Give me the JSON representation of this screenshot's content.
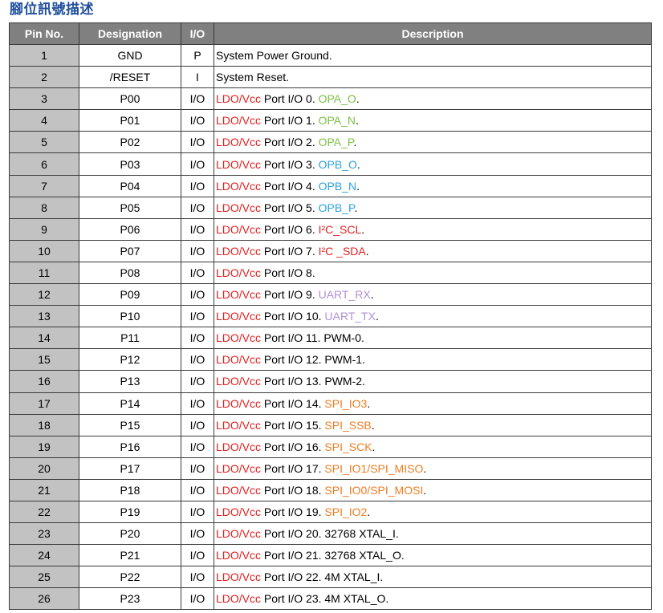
{
  "title": "腳位訊號描述",
  "headers": [
    "Pin No.",
    "Designation",
    "I/O",
    "Description"
  ],
  "colors": {
    "ldo": "#e51f1f",
    "green": "#7cc142",
    "blue": "#2aa3df",
    "purple": "#b28fd6",
    "orange": "#ef7d22",
    "header_bg": "#808080",
    "pin_bg": "#c2c2c2"
  },
  "rows": [
    {
      "pin": "1",
      "designation": "GND",
      "io": "P",
      "desc": [
        {
          "t": "System Power Ground.",
          "c": "bk"
        }
      ]
    },
    {
      "pin": "2",
      "designation": "/RESET",
      "io": "I",
      "desc": [
        {
          "t": "System Reset.",
          "c": "bk"
        }
      ]
    },
    {
      "pin": "3",
      "designation": "P00",
      "io": "I/O",
      "desc": [
        {
          "t": "LDO/Vcc",
          "c": "rd"
        },
        {
          "t": " Port I/O 0. ",
          "c": "bk"
        },
        {
          "t": "OPA_O",
          "c": "gn"
        },
        {
          "t": ".",
          "c": "bk"
        }
      ]
    },
    {
      "pin": "4",
      "designation": "P01",
      "io": "I/O",
      "desc": [
        {
          "t": "LDO/Vcc",
          "c": "rd"
        },
        {
          "t": " Port I/O 1. ",
          "c": "bk"
        },
        {
          "t": "OPA_N",
          "c": "gn"
        },
        {
          "t": ".",
          "c": "bk"
        }
      ]
    },
    {
      "pin": "5",
      "designation": "P02",
      "io": "I/O",
      "desc": [
        {
          "t": "LDO/Vcc",
          "c": "rd"
        },
        {
          "t": " Port I/O 2. ",
          "c": "bk"
        },
        {
          "t": "OPA_P",
          "c": "gn"
        },
        {
          "t": ".",
          "c": "bk"
        }
      ]
    },
    {
      "pin": "6",
      "designation": "P03",
      "io": "I/O",
      "desc": [
        {
          "t": "LDO/Vcc",
          "c": "rd"
        },
        {
          "t": " Port I/O 3. ",
          "c": "bk"
        },
        {
          "t": "OPB_O",
          "c": "bl"
        },
        {
          "t": ".",
          "c": "bk"
        }
      ]
    },
    {
      "pin": "7",
      "designation": "P04",
      "io": "I/O",
      "desc": [
        {
          "t": "LDO/Vcc",
          "c": "rd"
        },
        {
          "t": " Port I/O 4. ",
          "c": "bk"
        },
        {
          "t": "OPB_N",
          "c": "bl"
        },
        {
          "t": ".",
          "c": "bk"
        }
      ]
    },
    {
      "pin": "8",
      "designation": "P05",
      "io": "I/O",
      "desc": [
        {
          "t": "LDO/Vcc",
          "c": "rd"
        },
        {
          "t": " Port I/O 5. ",
          "c": "bk"
        },
        {
          "t": "OPB_P",
          "c": "bl"
        },
        {
          "t": ".",
          "c": "bk"
        }
      ]
    },
    {
      "pin": "9",
      "designation": "P06",
      "io": "I/O",
      "desc": [
        {
          "t": "LDO/Vcc",
          "c": "rd"
        },
        {
          "t": " Port I/O 6. ",
          "c": "bk"
        },
        {
          "t": "I²C_SCL",
          "c": "rd"
        },
        {
          "t": ".",
          "c": "bk"
        }
      ]
    },
    {
      "pin": "10",
      "designation": "P07",
      "io": "I/O",
      "desc": [
        {
          "t": "LDO/Vcc",
          "c": "rd"
        },
        {
          "t": " Port I/O 7. ",
          "c": "bk"
        },
        {
          "t": "I²C _SDA",
          "c": "rd"
        },
        {
          "t": ".",
          "c": "bk"
        }
      ]
    },
    {
      "pin": "11",
      "designation": "P08",
      "io": "I/O",
      "desc": [
        {
          "t": "LDO/Vcc",
          "c": "rd"
        },
        {
          "t": " Port I/O 8.",
          "c": "bk"
        }
      ]
    },
    {
      "pin": "12",
      "designation": "P09",
      "io": "I/O",
      "desc": [
        {
          "t": "LDO/Vcc",
          "c": "rd"
        },
        {
          "t": " Port I/O 9. ",
          "c": "bk"
        },
        {
          "t": "UART_RX",
          "c": "pu"
        },
        {
          "t": ".",
          "c": "bk"
        }
      ]
    },
    {
      "pin": "13",
      "designation": "P10",
      "io": "I/O",
      "desc": [
        {
          "t": "LDO/Vcc",
          "c": "rd"
        },
        {
          "t": " Port I/O 10. ",
          "c": "bk"
        },
        {
          "t": "UART_TX",
          "c": "pu"
        },
        {
          "t": ".",
          "c": "bk"
        }
      ]
    },
    {
      "pin": "14",
      "designation": "P11",
      "io": "I/O",
      "desc": [
        {
          "t": "LDO/Vcc",
          "c": "rd"
        },
        {
          "t": " Port I/O 11. PWM-0.",
          "c": "bk"
        }
      ]
    },
    {
      "pin": "15",
      "designation": "P12",
      "io": "I/O",
      "desc": [
        {
          "t": "LDO/Vcc",
          "c": "rd"
        },
        {
          "t": " Port I/O 12. PWM-1.",
          "c": "bk"
        }
      ]
    },
    {
      "pin": "16",
      "designation": "P13",
      "io": "I/O",
      "desc": [
        {
          "t": "LDO/Vcc",
          "c": "rd"
        },
        {
          "t": " Port I/O 13. PWM-2.",
          "c": "bk"
        }
      ]
    },
    {
      "pin": "17",
      "designation": "P14",
      "io": "I/O",
      "desc": [
        {
          "t": "LDO/Vcc",
          "c": "rd"
        },
        {
          "t": " Port I/O 14. ",
          "c": "bk"
        },
        {
          "t": "SPI_IO3",
          "c": "or"
        },
        {
          "t": ".",
          "c": "bk"
        }
      ]
    },
    {
      "pin": "18",
      "designation": "P15",
      "io": "I/O",
      "desc": [
        {
          "t": "LDO/Vcc",
          "c": "rd"
        },
        {
          "t": " Port I/O 15. ",
          "c": "bk"
        },
        {
          "t": "SPI_SSB",
          "c": "or"
        },
        {
          "t": ".",
          "c": "bk"
        }
      ]
    },
    {
      "pin": "19",
      "designation": "P16",
      "io": "I/O",
      "desc": [
        {
          "t": "LDO/Vcc",
          "c": "rd"
        },
        {
          "t": " Port I/O 16. ",
          "c": "bk"
        },
        {
          "t": "SPI_SCK",
          "c": "or"
        },
        {
          "t": ".",
          "c": "bk"
        }
      ]
    },
    {
      "pin": "20",
      "designation": "P17",
      "io": "I/O",
      "desc": [
        {
          "t": "LDO/Vcc",
          "c": "rd"
        },
        {
          "t": " Port I/O 17. ",
          "c": "bk"
        },
        {
          "t": "SPI_IO1/SPI_MISO",
          "c": "or"
        },
        {
          "t": ".",
          "c": "bk"
        }
      ]
    },
    {
      "pin": "21",
      "designation": "P18",
      "io": "I/O",
      "desc": [
        {
          "t": "LDO/Vcc",
          "c": "rd"
        },
        {
          "t": " Port I/O 18. ",
          "c": "bk"
        },
        {
          "t": "SPI_IO0/SPI_MOSI",
          "c": "or"
        },
        {
          "t": ".",
          "c": "bk"
        }
      ]
    },
    {
      "pin": "22",
      "designation": "P19",
      "io": "I/O",
      "desc": [
        {
          "t": "LDO/Vcc",
          "c": "rd"
        },
        {
          "t": " Port I/O 19. ",
          "c": "bk"
        },
        {
          "t": "SPI_IO2",
          "c": "or"
        },
        {
          "t": ".",
          "c": "bk"
        }
      ]
    },
    {
      "pin": "23",
      "designation": "P20",
      "io": "I/O",
      "desc": [
        {
          "t": "LDO/Vcc",
          "c": "rd"
        },
        {
          "t": " Port I/O 20. 32768 XTAL_I.",
          "c": "bk"
        }
      ]
    },
    {
      "pin": "24",
      "designation": "P21",
      "io": "I/O",
      "desc": [
        {
          "t": "LDO/Vcc",
          "c": "rd"
        },
        {
          "t": " Port I/O 21. 32768 XTAL_O.",
          "c": "bk"
        }
      ]
    },
    {
      "pin": "25",
      "designation": "P22",
      "io": "I/O",
      "desc": [
        {
          "t": "LDO/Vcc",
          "c": "rd"
        },
        {
          "t": " Port I/O 22. 4M XTAL_I.",
          "c": "bk"
        }
      ]
    },
    {
      "pin": "26",
      "designation": "P23",
      "io": "I/O",
      "desc": [
        {
          "t": "LDO/Vcc",
          "c": "rd"
        },
        {
          "t": " Port I/O 23. 4M XTAL_O.",
          "c": "bk"
        }
      ]
    }
  ]
}
